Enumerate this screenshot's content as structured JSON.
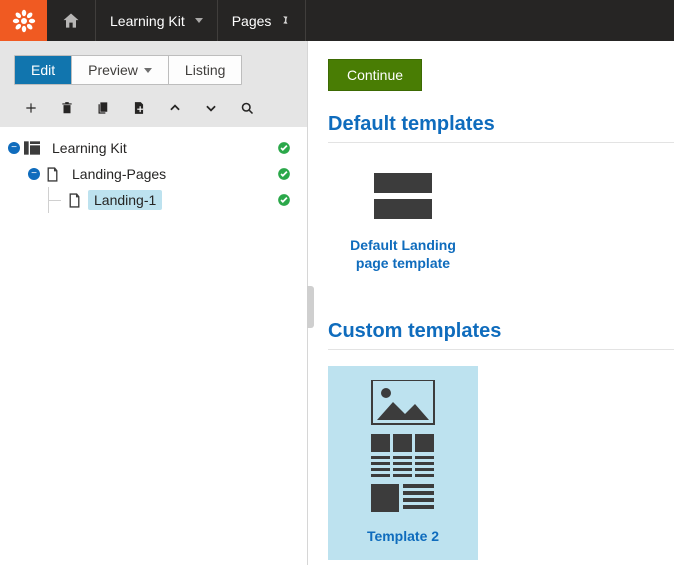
{
  "topbar": {
    "breadcrumb": "Learning Kit",
    "app": "Pages"
  },
  "modes": {
    "edit": "Edit",
    "preview": "Preview",
    "listing": "Listing"
  },
  "tree": {
    "root": "Learning Kit",
    "child1": "Landing-Pages",
    "child2": "Landing-1"
  },
  "right": {
    "continue": "Continue",
    "default_section": "Default templates",
    "default_template": "Default Landing page template",
    "custom_section": "Custom templates",
    "custom_template": "Template 2"
  }
}
